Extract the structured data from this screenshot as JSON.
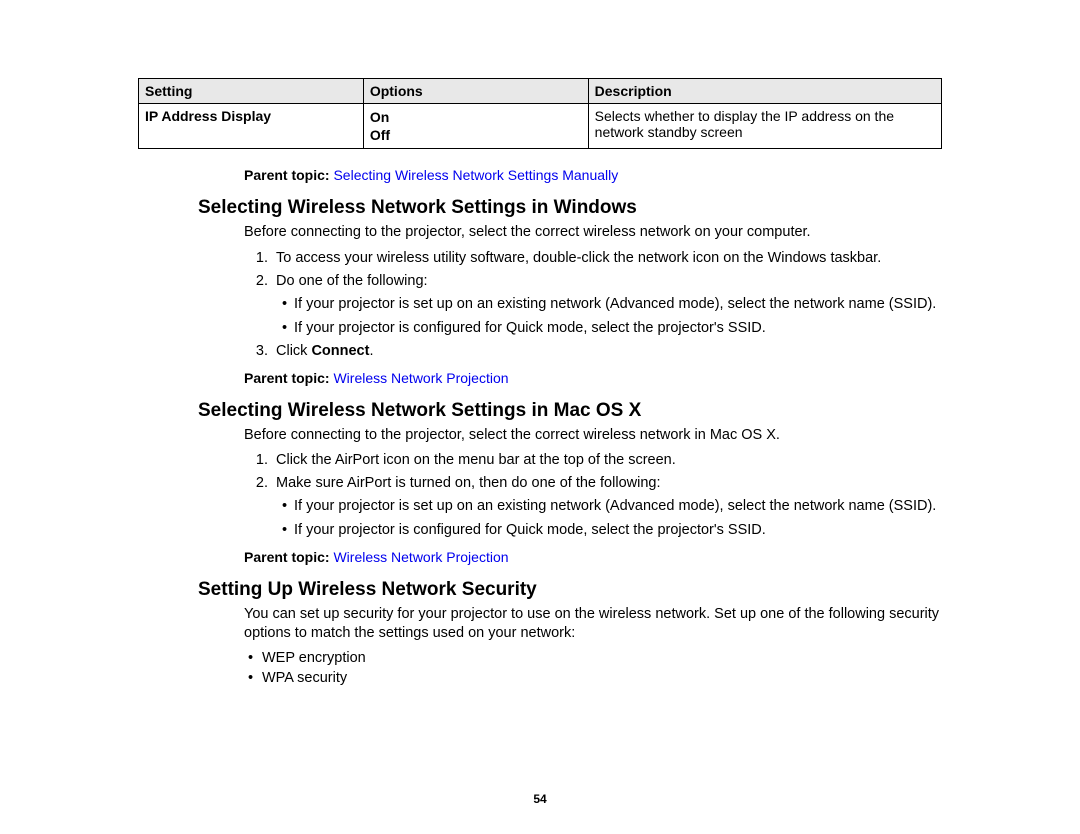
{
  "table": {
    "headers": {
      "setting": "Setting",
      "options": "Options",
      "description": "Description"
    },
    "row": {
      "setting": "IP Address Display",
      "option1": "On",
      "option2": "Off",
      "description": "Selects whether to display the IP address on the network standby screen"
    }
  },
  "pt1": {
    "label": "Parent topic: ",
    "link": "Selecting Wireless Network Settings Manually"
  },
  "sec1": {
    "heading": "Selecting Wireless Network Settings in Windows",
    "intro": "Before connecting to the projector, select the correct wireless network on your computer.",
    "step1": "To access your wireless utility software, double-click the network icon on the Windows taskbar.",
    "step2": "Do one of the following:",
    "step2a": "If your projector is set up on an existing network (Advanced mode), select the network name (SSID).",
    "step2b": "If your projector is configured for Quick mode, select the projector's SSID.",
    "step3_pre": "Click ",
    "step3_bold": "Connect",
    "step3_post": ".",
    "pt": {
      "label": "Parent topic: ",
      "link": "Wireless Network Projection"
    }
  },
  "sec2": {
    "heading": "Selecting Wireless Network Settings in Mac OS X",
    "intro": "Before connecting to the projector, select the correct wireless network in Mac OS X.",
    "step1": "Click the AirPort icon on the menu bar at the top of the screen.",
    "step2": "Make sure AirPort is turned on, then do one of the following:",
    "step2a": "If your projector is set up on an existing network (Advanced mode), select the network name (SSID).",
    "step2b": "If your projector is configured for Quick mode, select the projector's SSID.",
    "pt": {
      "label": "Parent topic: ",
      "link": "Wireless Network Projection"
    }
  },
  "sec3": {
    "heading": "Setting Up Wireless Network Security",
    "intro": "You can set up security for your projector to use on the wireless network. Set up one of the following security options to match the settings used on your network:",
    "b1": "WEP encryption",
    "b2": "WPA security"
  },
  "page": "54"
}
